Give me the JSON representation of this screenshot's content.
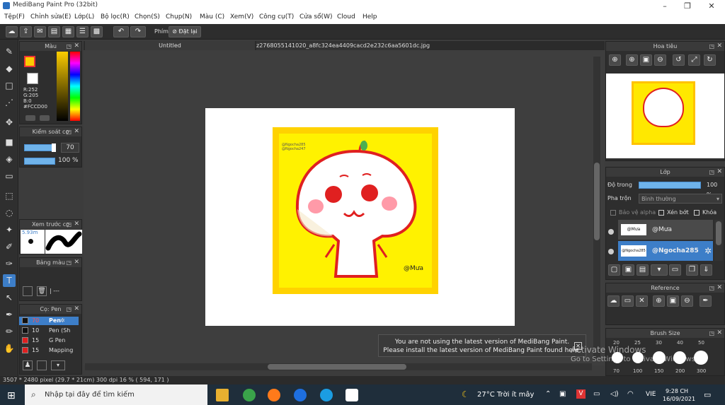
{
  "window": {
    "title": "MediBang Paint Pro (32bit)"
  },
  "menu": [
    "Tệp(F)",
    "Chỉnh sửa(E)",
    "Lớp(L)",
    "Bộ lọc(R)",
    "Chọn(S)",
    "Chụp(N)",
    "Màu (C)",
    "Xem(V)",
    "Công cụ(T)",
    "Cửa sổ(W)",
    "Cloud",
    "Help"
  ],
  "toolbar": {
    "phim_label": "Phím",
    "reset_label": "Đặt lại"
  },
  "tabs": [
    "Untitled",
    "z2768055141020_a8fc324ea4409cacd2e232c6aa5601dc.jpg"
  ],
  "color_panel": {
    "title": "Màu",
    "r": "R:252",
    "g": "G:205",
    "b": "B:0",
    "hex": "#FCCD00",
    "fg_color": "#fccd00",
    "bg_color": "#ffffff"
  },
  "brush_control": {
    "title": "Kiểm soát cọ",
    "size": "70",
    "opacity": "100 %"
  },
  "brush_preview": {
    "title": "Xem trước cọ",
    "size": "5.93m"
  },
  "palette": {
    "title": "Bảng màu",
    "info": "| ---"
  },
  "brush_list": {
    "title": "Cọ: Pen",
    "items": [
      {
        "size": "70",
        "name": "Pen",
        "selected": true,
        "color": "#111111"
      },
      {
        "size": "10",
        "name": "Pen (Sh",
        "selected": false,
        "color": "#111111"
      },
      {
        "size": "15",
        "name": "G Pen",
        "selected": false,
        "color": "#e02020"
      },
      {
        "size": "15",
        "name": "Mapping",
        "selected": false,
        "color": "#e02020"
      }
    ]
  },
  "artwork": {
    "credit1": "@Ngocha285",
    "credit2": "@Ngocha247",
    "signature": "@Mưa"
  },
  "notice": {
    "line1": "You are not using the latest version of MediBang Paint.",
    "line2": "Please install the latest version of MediBang Paint found here."
  },
  "navigator": {
    "title": "Hoa tiêu"
  },
  "layers": {
    "title": "Lớp",
    "opacity_label": "Độ trong",
    "opacity_value": "100 %",
    "blend_label": "Pha trộn",
    "blend_value": "Bình thường",
    "protect_alpha": "Bảo vệ alpha",
    "clip": "Xén bớt",
    "lock": "Khóa",
    "items": [
      {
        "name": "@Mưa",
        "thumb": "@Mưa",
        "selected": false
      },
      {
        "name": "@Ngocha285",
        "thumb": "@Ngocha285",
        "selected": true
      }
    ]
  },
  "reference": {
    "title": "Reference"
  },
  "brush_size": {
    "title": "Brush Size",
    "top": [
      "20",
      "25",
      "30",
      "40",
      "50"
    ],
    "bottom": [
      "70",
      "100",
      "150",
      "200",
      "300"
    ]
  },
  "watermark": {
    "line1": "Activate Windows",
    "line2": "Go to Settings to activate Windows."
  },
  "status": {
    "text": "3507 * 2480 pixel  (29.7 * 21cm)  300 dpi  16 %  ( 594, 171 )"
  },
  "taskbar": {
    "search": "Nhập tại đây để tìm kiếm",
    "weather": "27°C  Trời ít mây",
    "lang": "VIE",
    "time": "9:28 CH",
    "date": "16/09/2021"
  }
}
